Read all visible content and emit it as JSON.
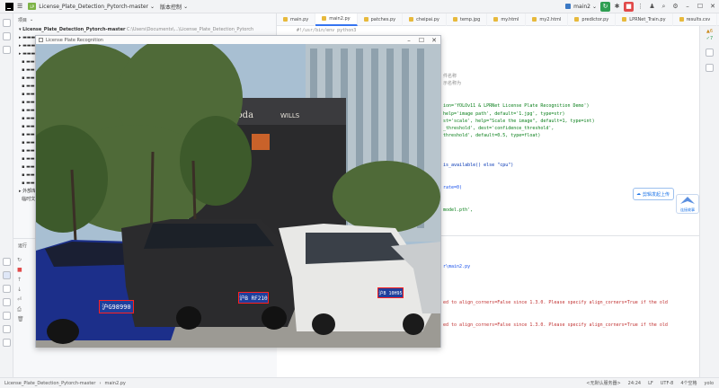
{
  "titlebar": {
    "project_badge": "LP",
    "project_name": "License_Plate_Detection_Pytorch-master",
    "vcs_label": "版本控制",
    "run_config": "main2"
  },
  "tabs": [
    {
      "label": "main.py"
    },
    {
      "label": "main2.py",
      "active": true
    },
    {
      "label": "patches.py"
    },
    {
      "label": "cheipai.py"
    },
    {
      "label": "temp.jpg"
    },
    {
      "label": "my.html"
    },
    {
      "label": "my2.html"
    },
    {
      "label": "predictor.py"
    },
    {
      "label": "LPRNet_Train.py"
    },
    {
      "label": "results.csv"
    }
  ],
  "project_panel": {
    "header": "项目",
    "root": "License_Plate_Detection_Pytorch-master",
    "root_path": "C:\\Users\\Documents\\...\\License_Plate_Detection_Pytorch",
    "external_libs": "外部库",
    "scratches": "临时文件和控制台"
  },
  "run_panel": {
    "header": "运行"
  },
  "image_window": {
    "title": "License Plate Recognition",
    "sign_text": "Pagoda",
    "sign_text2": "WILLS"
  },
  "plates": [
    {
      "text": "沪G98990"
    },
    {
      "text": "沪B RF210"
    },
    {
      "text": "沪B 10H95"
    }
  ],
  "code": {
    "line1": "#!/usr/bin/env python3",
    "line2": "件名称",
    "line3": "示名称为",
    "line4": "ion='YOLOv11 & LPRNet License Plate Recognition Demo')",
    "line5": "help='image path', default='1.jpg', type=str)",
    "line6": "st='scale', help=\"Scale the image\", default=1, type=int)",
    "line7": "_threshold', dest='confidence_threshold',",
    "line8": "threshold', default=0.5, type=float)",
    "line9": "is_available() else \"cpu\")",
    "line10": "rate=0)",
    "line11": "model.pth',"
  },
  "console": {
    "line1": "r\\main2.py",
    "line2": "ed to align_corners=False since 1.3.0. Please specify align_corners=True if the old",
    "line3": "ed to align_corners=False since 1.3.0. Please specify align_corners=True if the old"
  },
  "right_widgets": {
    "warn_count": "6",
    "ok_count": "7",
    "float_label": "剪辑发起上传",
    "float_label2": "连接故事"
  },
  "statusbar": {
    "path1": "License_Plate_Detection_Pytorch-master",
    "path2": "main2.py",
    "hint": "<无默认服务器>",
    "position": "24:24",
    "line_sep": "LF",
    "encoding": "UTF-8",
    "indent": "4个空格",
    "interpreter": "yolo"
  }
}
